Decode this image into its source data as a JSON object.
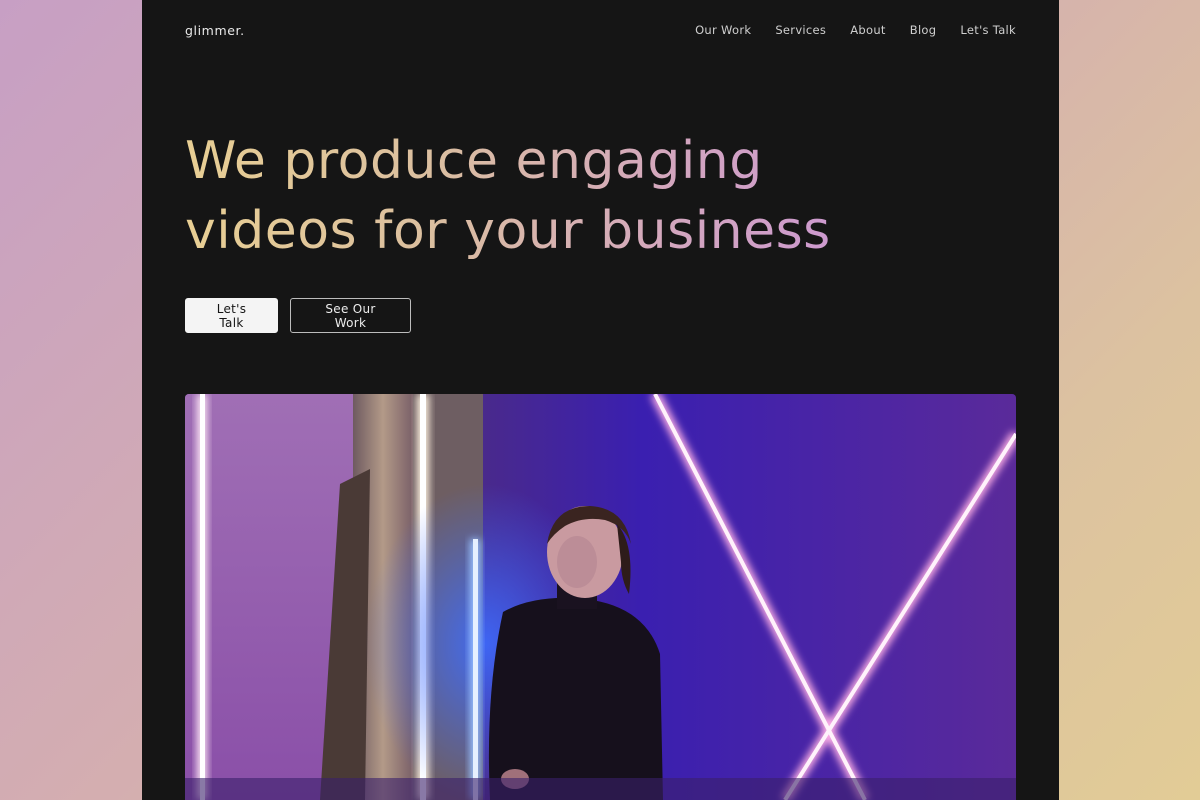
{
  "brand": {
    "logo": "glimmer."
  },
  "nav": {
    "items": [
      {
        "label": "Our Work"
      },
      {
        "label": "Services"
      },
      {
        "label": "About"
      },
      {
        "label": "Blog"
      },
      {
        "label": "Let's Talk"
      }
    ]
  },
  "hero": {
    "title_line1": "We produce engaging",
    "title_line2": "videos for your business",
    "gradient_colors": [
      "#e8cf94",
      "#d3a6bf",
      "#c68ce0"
    ]
  },
  "cta": {
    "primary_label": "Let's Talk",
    "secondary_label": "See Our Work"
  },
  "colors": {
    "page_background": "#151515",
    "primary_button": "#f4f4f4",
    "text": "#e9e9e9"
  },
  "media": {
    "subject": "neon-lit portrait video still"
  }
}
